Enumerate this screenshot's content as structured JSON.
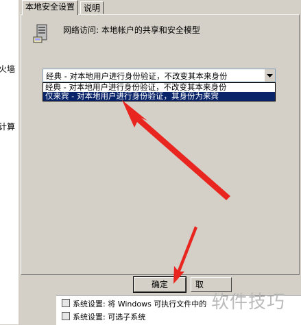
{
  "background_window": {
    "left_text_1": "火墙",
    "left_text_2": "计算"
  },
  "tabs": [
    {
      "label": "本地安全设置"
    },
    {
      "label": "说明"
    }
  ],
  "policy": {
    "title": "网络访问: 本地帐户的共享和安全模型",
    "icon": "server-icon"
  },
  "combo": {
    "selected": "经典 - 对本地用户进行身份验证，不改变其本来身份"
  },
  "dropdown": {
    "options": [
      "经典 - 对本地用户进行身份验证，不改变其本来身份",
      "仅来宾 - 对本地用户进行身份验证，其身份为来宾"
    ],
    "highlighted_index": 1
  },
  "buttons": {
    "ok": "确定",
    "partial": "取"
  },
  "background_list": [
    "系统设置: 将 Windows 可执行文件中的",
    "系统设置: 可选子系统"
  ],
  "watermark": "软件技巧",
  "colors": {
    "dialog_bg": "#d4d0c8",
    "selection": "#0a246a",
    "annotation_arrow": "#e8261f"
  }
}
